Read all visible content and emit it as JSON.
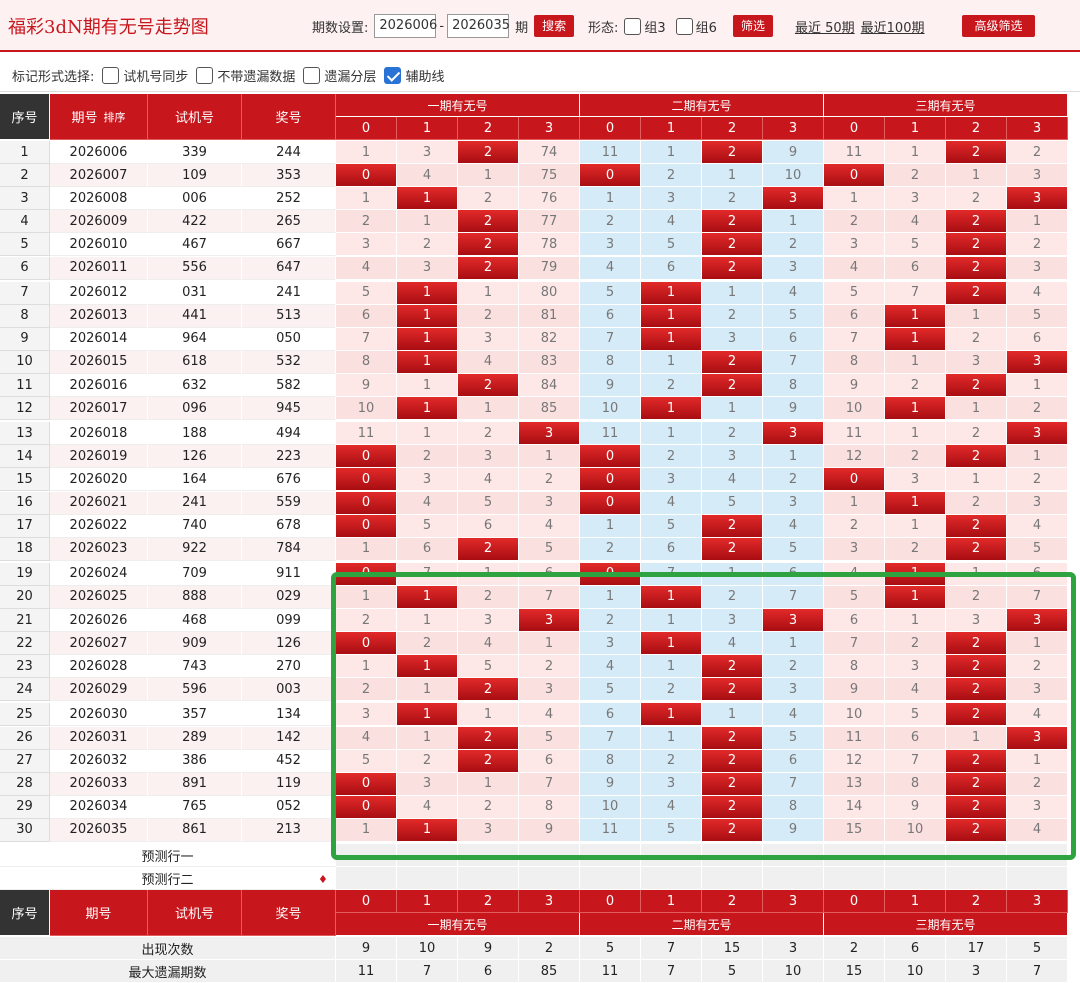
{
  "title": "福彩3dN期有无号走势图",
  "period": {
    "label": "期数设置:",
    "from": "2026006",
    "dash": "-",
    "to": "2026035",
    "unit": "期",
    "search": "搜索"
  },
  "form": {
    "label": "形态:",
    "g3": "组3",
    "g6": "组6",
    "filter": "筛选",
    "last50": "最近 50期",
    "last100": "最近100期",
    "advanced": "高级筛选"
  },
  "mark": {
    "label": "标记形式选择:",
    "opt1": "试机号同步",
    "opt2": "不带遗漏数据",
    "opt3": "遗漏分层",
    "opt4": "辅助线"
  },
  "headers": {
    "seq": "序号",
    "period": "期号",
    "test": "试机号",
    "prize": "奖号",
    "g1": "一期有无号",
    "g2": "二期有无号",
    "g3": "三期有无号",
    "digits": [
      "0",
      "1",
      "2",
      "3"
    ],
    "sort": "排序"
  },
  "rows": [
    [
      "1",
      "2026006",
      "339",
      "244",
      [
        1,
        3,
        "2",
        74
      ],
      [
        11,
        1,
        "2",
        9
      ],
      [
        11,
        1,
        "2",
        2
      ]
    ],
    [
      "2",
      "2026007",
      "109",
      "353",
      [
        "0",
        4,
        1,
        75
      ],
      [
        "0",
        2,
        1,
        10
      ],
      [
        "0",
        2,
        1,
        3
      ]
    ],
    [
      "3",
      "2026008",
      "006",
      "252",
      [
        1,
        "1",
        2,
        76
      ],
      [
        1,
        3,
        2,
        "3"
      ],
      [
        1,
        3,
        2,
        "3"
      ]
    ],
    [
      "4",
      "2026009",
      "422",
      "265",
      [
        2,
        1,
        "2",
        77
      ],
      [
        2,
        4,
        "2",
        1
      ],
      [
        2,
        4,
        "2",
        1
      ]
    ],
    [
      "5",
      "2026010",
      "467",
      "667",
      [
        3,
        2,
        "2",
        78
      ],
      [
        3,
        5,
        "2",
        2
      ],
      [
        3,
        5,
        "2",
        2
      ]
    ],
    [
      "6",
      "2026011",
      "556",
      "647",
      [
        4,
        3,
        "2",
        79
      ],
      [
        4,
        6,
        "2",
        3
      ],
      [
        4,
        6,
        "2",
        3
      ]
    ],
    [
      "7",
      "2026012",
      "031",
      "241",
      [
        5,
        "1",
        1,
        80
      ],
      [
        5,
        "1",
        1,
        4
      ],
      [
        5,
        7,
        "2",
        4
      ]
    ],
    [
      "8",
      "2026013",
      "441",
      "513",
      [
        6,
        "1",
        2,
        81
      ],
      [
        6,
        "1",
        2,
        5
      ],
      [
        6,
        "1",
        1,
        5
      ]
    ],
    [
      "9",
      "2026014",
      "964",
      "050",
      [
        7,
        "1",
        3,
        82
      ],
      [
        7,
        "1",
        3,
        6
      ],
      [
        7,
        "1",
        2,
        6
      ]
    ],
    [
      "10",
      "2026015",
      "618",
      "532",
      [
        8,
        "1",
        4,
        83
      ],
      [
        8,
        1,
        "2",
        7
      ],
      [
        8,
        1,
        3,
        "3"
      ]
    ],
    [
      "11",
      "2026016",
      "632",
      "582",
      [
        9,
        1,
        "2",
        84
      ],
      [
        9,
        2,
        "2",
        8
      ],
      [
        9,
        2,
        "2",
        1
      ]
    ],
    [
      "12",
      "2026017",
      "096",
      "945",
      [
        10,
        "1",
        1,
        85
      ],
      [
        10,
        "1",
        1,
        9
      ],
      [
        10,
        "1",
        1,
        2
      ]
    ],
    [
      "13",
      "2026018",
      "188",
      "494",
      [
        11,
        1,
        2,
        "3"
      ],
      [
        11,
        1,
        2,
        "3"
      ],
      [
        11,
        1,
        2,
        "3"
      ]
    ],
    [
      "14",
      "2026019",
      "126",
      "223",
      [
        "0",
        2,
        3,
        1
      ],
      [
        "0",
        2,
        3,
        1
      ],
      [
        12,
        2,
        "2",
        1
      ]
    ],
    [
      "15",
      "2026020",
      "164",
      "676",
      [
        "0",
        3,
        4,
        2
      ],
      [
        "0",
        3,
        4,
        2
      ],
      [
        "0",
        3,
        1,
        2
      ]
    ],
    [
      "16",
      "2026021",
      "241",
      "559",
      [
        "0",
        4,
        5,
        3
      ],
      [
        "0",
        4,
        5,
        3
      ],
      [
        1,
        "1",
        2,
        3
      ]
    ],
    [
      "17",
      "2026022",
      "740",
      "678",
      [
        "0",
        5,
        6,
        4
      ],
      [
        1,
        5,
        "2",
        4
      ],
      [
        2,
        1,
        "2",
        4
      ]
    ],
    [
      "18",
      "2026023",
      "922",
      "784",
      [
        1,
        6,
        "2",
        5
      ],
      [
        2,
        6,
        "2",
        5
      ],
      [
        3,
        2,
        "2",
        5
      ]
    ],
    [
      "19",
      "2026024",
      "709",
      "911",
      [
        "0",
        7,
        1,
        6
      ],
      [
        "0",
        7,
        1,
        6
      ],
      [
        4,
        "1",
        1,
        6
      ]
    ],
    [
      "20",
      "2026025",
      "888",
      "029",
      [
        1,
        "1",
        2,
        7
      ],
      [
        1,
        "1",
        2,
        7
      ],
      [
        5,
        "1",
        2,
        7
      ]
    ],
    [
      "21",
      "2026026",
      "468",
      "099",
      [
        2,
        1,
        3,
        "3"
      ],
      [
        2,
        1,
        3,
        "3"
      ],
      [
        6,
        1,
        3,
        "3"
      ]
    ],
    [
      "22",
      "2026027",
      "909",
      "126",
      [
        "0",
        2,
        4,
        1
      ],
      [
        3,
        "1",
        4,
        1
      ],
      [
        7,
        2,
        "2",
        1
      ]
    ],
    [
      "23",
      "2026028",
      "743",
      "270",
      [
        1,
        "1",
        5,
        2
      ],
      [
        4,
        1,
        "2",
        2
      ],
      [
        8,
        3,
        "2",
        2
      ]
    ],
    [
      "24",
      "2026029",
      "596",
      "003",
      [
        2,
        1,
        "2",
        3
      ],
      [
        5,
        2,
        "2",
        3
      ],
      [
        9,
        4,
        "2",
        3
      ]
    ],
    [
      "25",
      "2026030",
      "357",
      "134",
      [
        3,
        "1",
        1,
        4
      ],
      [
        6,
        "1",
        1,
        4
      ],
      [
        10,
        5,
        "2",
        4
      ]
    ],
    [
      "26",
      "2026031",
      "289",
      "142",
      [
        4,
        1,
        "2",
        5
      ],
      [
        7,
        1,
        "2",
        5
      ],
      [
        11,
        6,
        1,
        "3"
      ]
    ],
    [
      "27",
      "2026032",
      "386",
      "452",
      [
        5,
        2,
        "2",
        6
      ],
      [
        8,
        2,
        "2",
        6
      ],
      [
        12,
        7,
        "2",
        1
      ]
    ],
    [
      "28",
      "2026033",
      "891",
      "119",
      [
        "0",
        3,
        1,
        7
      ],
      [
        9,
        3,
        "2",
        7
      ],
      [
        13,
        8,
        "2",
        2
      ]
    ],
    [
      "29",
      "2026034",
      "765",
      "052",
      [
        "0",
        4,
        2,
        8
      ],
      [
        10,
        4,
        "2",
        8
      ],
      [
        14,
        9,
        "2",
        3
      ]
    ],
    [
      "30",
      "2026035",
      "861",
      "213",
      [
        1,
        "1",
        3,
        9
      ],
      [
        11,
        5,
        "2",
        9
      ],
      [
        15,
        10,
        "2",
        4
      ]
    ]
  ],
  "forecast": [
    "预测行一",
    "预测行二"
  ],
  "stats": [
    {
      "label": "出现次数",
      "values": [
        "9",
        "10",
        "9",
        "2",
        "5",
        "7",
        "15",
        "3",
        "2",
        "6",
        "17",
        "5"
      ]
    },
    {
      "label": "最大遗漏期数",
      "values": [
        "11",
        "7",
        "6",
        "85",
        "11",
        "7",
        "5",
        "10",
        "15",
        "10",
        "3",
        "7"
      ]
    }
  ]
}
